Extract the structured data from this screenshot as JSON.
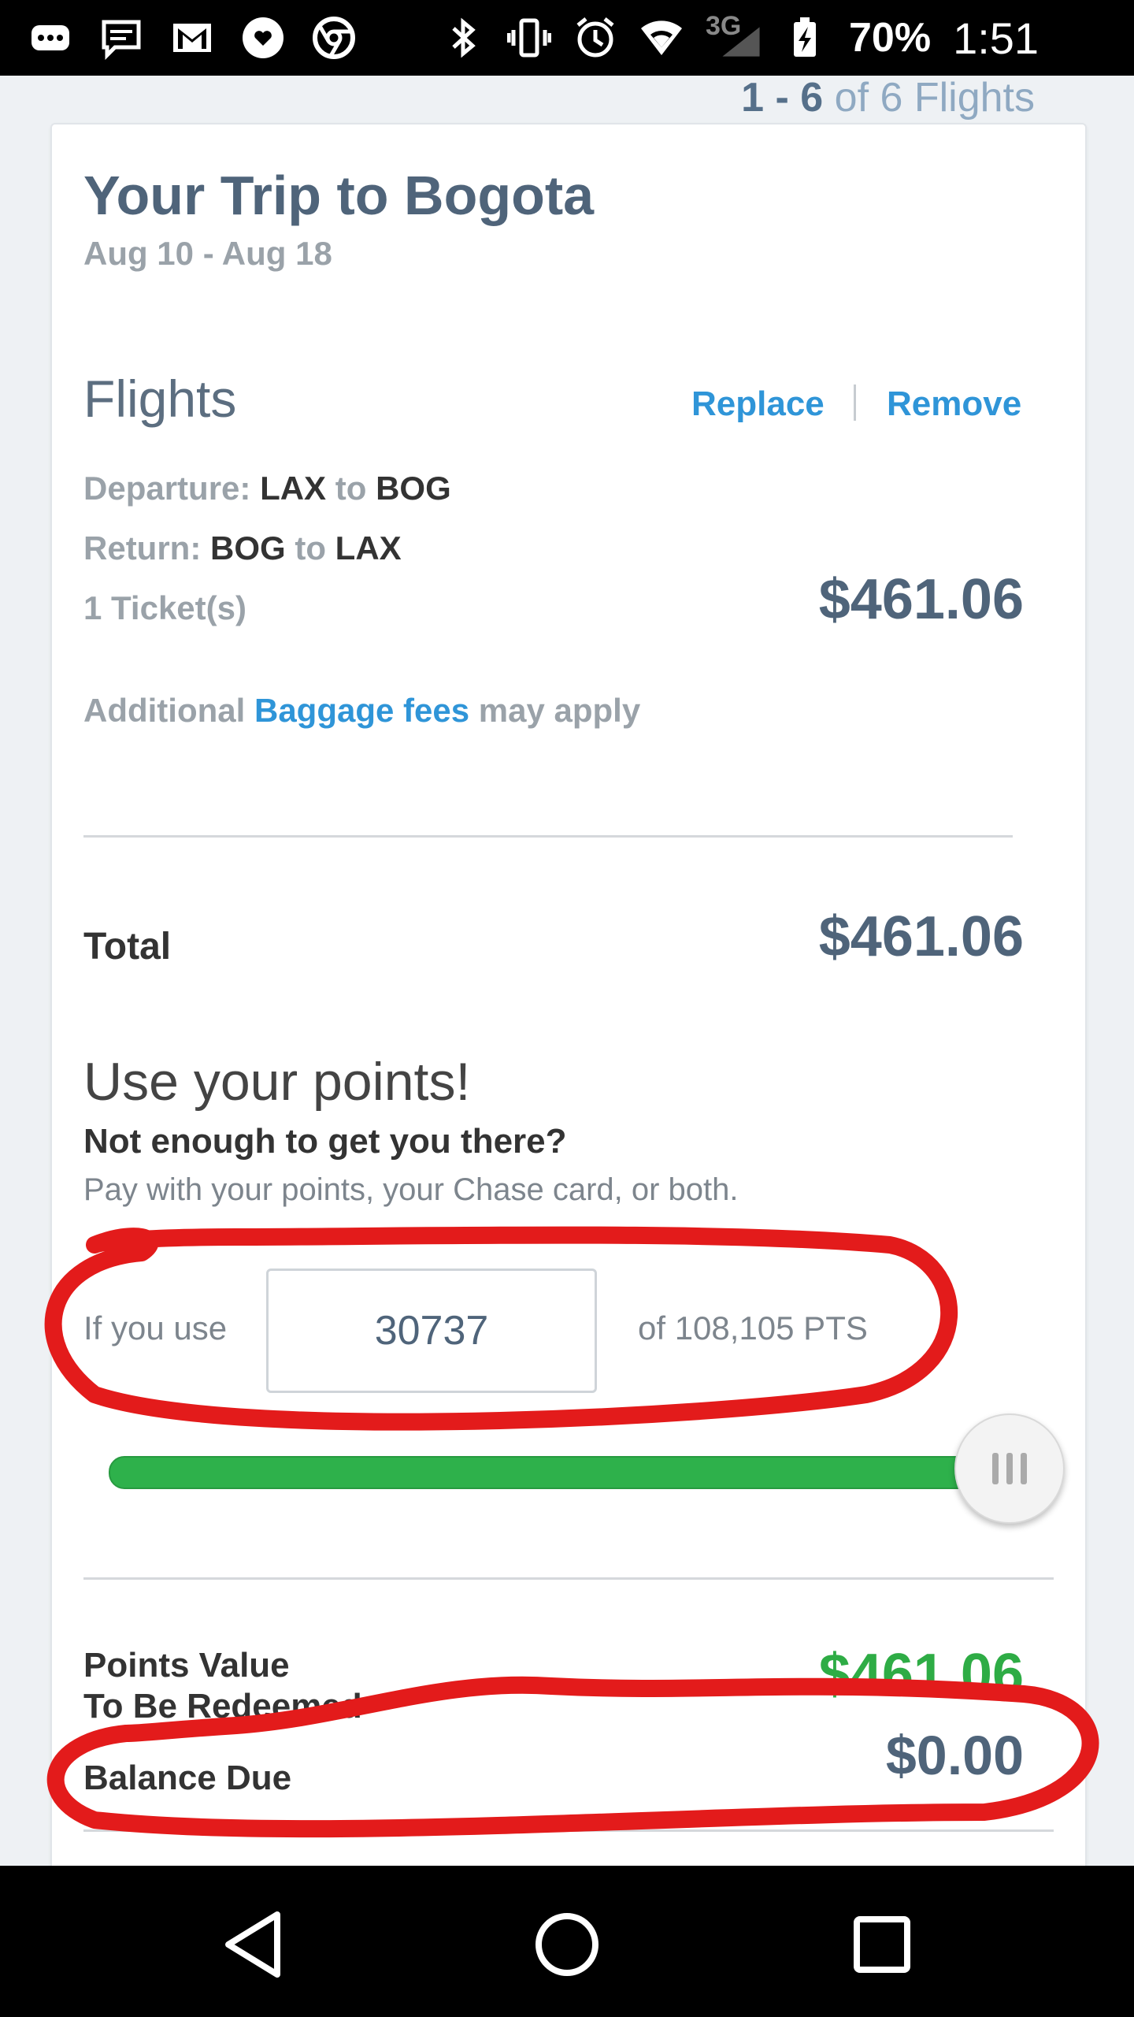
{
  "status_bar": {
    "battery_percent": "70%",
    "time": "1:51",
    "network": "3G",
    "icons_left": [
      "more-icon",
      "message-icon",
      "gmail-icon",
      "heart-icon",
      "chrome-icon"
    ],
    "icons_right": [
      "bluetooth-icon",
      "vibrate-icon",
      "alarm-icon",
      "wifi-icon",
      "signal-icon",
      "battery-icon"
    ]
  },
  "pager": {
    "range": "1 - 6",
    "of_text": "of 6 Flights"
  },
  "trip": {
    "title": "Your Trip to Bogota",
    "dates": "Aug 10 - Aug 18"
  },
  "flights": {
    "title": "Flights",
    "replace_label": "Replace",
    "remove_label": "Remove",
    "departure": {
      "label": "Departure:",
      "from": "LAX",
      "to_word": "to",
      "to": "BOG"
    },
    "return": {
      "label": "Return:",
      "from": "BOG",
      "to_word": "to",
      "to": "LAX"
    },
    "tickets": "1 Ticket(s)",
    "price": "$461.06",
    "baggage": {
      "pre": "Additional",
      "link": "Baggage fees",
      "post": "may apply"
    }
  },
  "total": {
    "label": "Total",
    "amount": "$461.06"
  },
  "points": {
    "title": "Use your points!",
    "subtitle": "Not enough to get you there?",
    "description": "Pay with your points, your Chase card, or both.",
    "if_you_use": "If you use",
    "input_value": "30737",
    "of_total": "of 108,105 PTS",
    "slider_fraction": 1.0
  },
  "summary": {
    "points_value_label_line1": "Points Value",
    "points_value_label_line2": "To Be Redeemed",
    "points_value_amount": "$461.06",
    "balance_due_label": "Balance Due",
    "balance_due_amount": "$0.00"
  },
  "colors": {
    "accent_blue": "#2f95d8",
    "heading_slate": "#4f647a",
    "success_green": "#2eac45",
    "annotation_red": "#e31b1b"
  }
}
